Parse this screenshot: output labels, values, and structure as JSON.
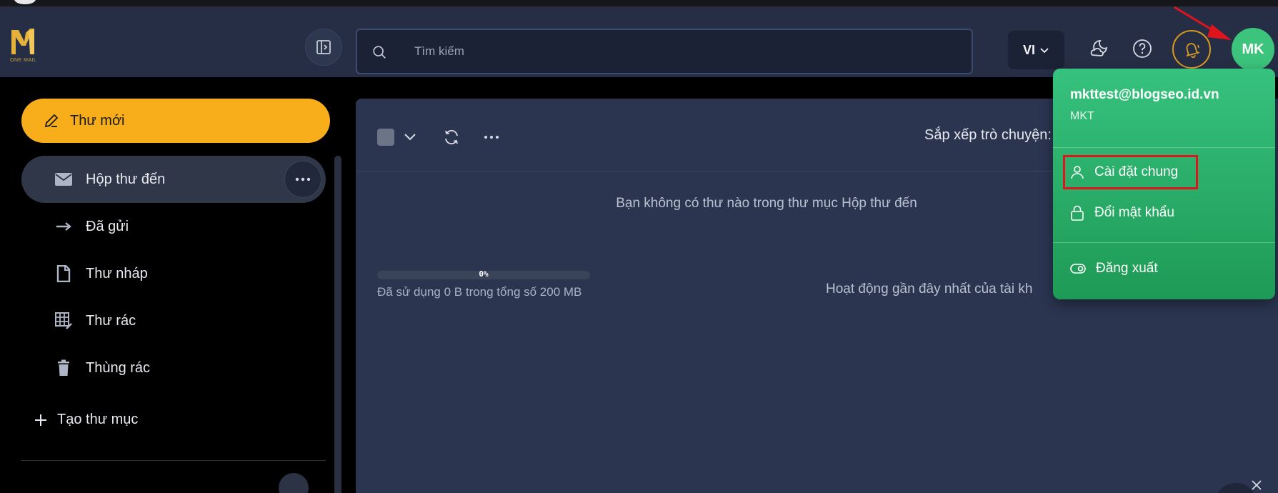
{
  "header": {
    "search_placeholder": "Tìm kiếm",
    "language": "VI",
    "avatar_initials": "MK",
    "logo_text": "ONE MAIL"
  },
  "sidebar": {
    "compose_label": "Thư mới",
    "items": [
      {
        "label": "Hộp thư đến",
        "icon": "mail-icon",
        "active": true
      },
      {
        "label": "Đã gửi",
        "icon": "arrow-right-icon",
        "active": false
      },
      {
        "label": "Thư nháp",
        "icon": "file-icon",
        "active": false
      },
      {
        "label": "Thư rác",
        "icon": "spam-grid-icon",
        "active": false
      },
      {
        "label": "Thùng rác",
        "icon": "trash-icon",
        "active": false
      }
    ],
    "create_folder_label": "Tạo thư mục"
  },
  "main": {
    "sort_label": "Sắp xếp trò chuyện:",
    "empty_message": "Bạn không có thư nào trong thư mục Hộp thư đến",
    "storage_percent": "0%",
    "storage_fraction": 0,
    "storage_text": "Đã sử dụng 0 B trong tổng số 200 MB",
    "activity_text": "Hoạt động gần đây nhất của tài kh"
  },
  "account_menu": {
    "email": "mkttest@blogseo.id.vn",
    "name": "MKT",
    "items": [
      {
        "label": "Cài đặt chung",
        "icon": "user-icon"
      },
      {
        "label": "Đổi mật khẩu",
        "icon": "lock-icon"
      },
      {
        "label": "Đăng xuất",
        "icon": "toggle-icon"
      }
    ]
  },
  "colors": {
    "header_bg": "#262e46",
    "main_bg": "#2b3550",
    "compose_accent": "#f7ae1a",
    "menu_green": "#36c27e",
    "avatar_green": "#3cc47c",
    "annotation_red": "#e0141c"
  }
}
